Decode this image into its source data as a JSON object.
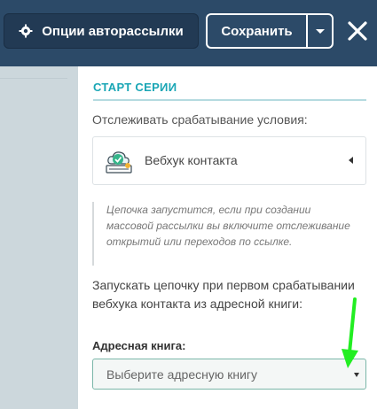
{
  "header": {
    "options_label": "Опции авторассылки",
    "save_label": "Сохранить"
  },
  "panel": {
    "section_title": "СТАРТ СЕРИИ",
    "track_label": "Отслеживать срабатывание условия:",
    "webhook_label": "Вебхук контакта",
    "note": "Цепочка запустится, если при создании массовой рассылки вы включите отслеживание открытий или переходов по ссылке.",
    "description": "Запускать цепочку при первом срабатывании вебхука контакта из адресной книги:",
    "book_label": "Адресная книга:",
    "book_placeholder": "Выберите адресную книгу"
  },
  "colors": {
    "header_bg": "#2c4a68",
    "accent": "#1aa6b5",
    "annotation_arrow": "#22ee22"
  },
  "icons": [
    "gear-icon",
    "close-icon",
    "chevron-down-icon",
    "webhook-cloud-icon",
    "caret-left-icon",
    "caret-down-icon",
    "annotation-arrow-icon"
  ]
}
